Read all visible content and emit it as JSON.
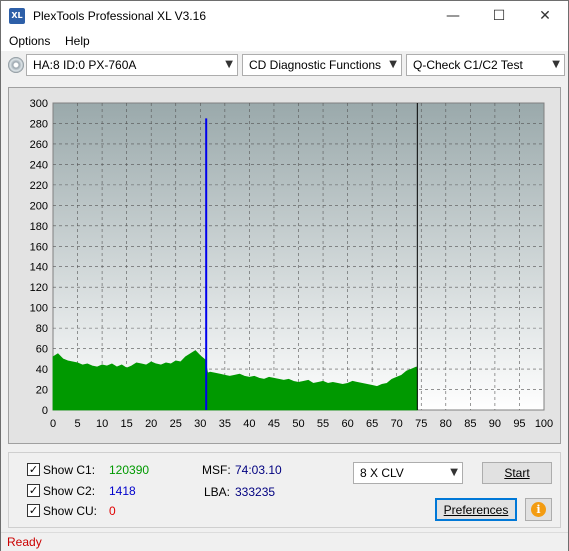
{
  "window": {
    "title": "PlexTools Professional XL V3.16",
    "icon_text": "XL",
    "minimize": "—",
    "maximize": "☐",
    "close": "✕"
  },
  "menu": {
    "items": [
      "Options",
      "Help"
    ]
  },
  "toolbar": {
    "drive": "HA:8 ID:0  PX-760A",
    "function": "CD Diagnostic Functions",
    "test": "Q-Check C1/C2 Test"
  },
  "chart_data": {
    "type": "area",
    "title": "",
    "xlabel": "",
    "ylabel": "",
    "xlim": [
      0,
      100
    ],
    "ylim": [
      0,
      300
    ],
    "x_ticks": [
      0,
      5,
      10,
      15,
      20,
      25,
      30,
      35,
      40,
      45,
      50,
      55,
      60,
      65,
      70,
      75,
      80,
      85,
      90,
      95,
      100
    ],
    "y_ticks": [
      0,
      20,
      40,
      60,
      80,
      100,
      120,
      140,
      160,
      180,
      200,
      220,
      240,
      260,
      280,
      300
    ],
    "grid": true,
    "colors": {
      "c1": "#009900",
      "c2_marker": "#0000ee",
      "end_marker": "#000000"
    },
    "series": [
      {
        "name": "C1",
        "x": [
          0,
          1,
          2,
          3,
          4,
          5,
          6,
          7,
          8,
          9,
          10,
          11,
          12,
          13,
          14,
          15,
          16,
          17,
          18,
          19,
          20,
          21,
          22,
          23,
          24,
          25,
          26,
          27,
          28,
          29,
          30,
          31,
          31.5,
          32,
          33,
          34,
          35,
          36,
          37,
          38,
          39,
          40,
          41,
          42,
          43,
          44,
          45,
          46,
          47,
          48,
          49,
          50,
          51,
          52,
          53,
          54,
          55,
          56,
          57,
          58,
          59,
          60,
          61,
          62,
          63,
          64,
          65,
          66,
          67,
          68,
          69,
          70,
          71,
          72,
          73,
          74,
          74.2
        ],
        "y": [
          52,
          55,
          50,
          48,
          47,
          46,
          44,
          45,
          43,
          42,
          44,
          43,
          45,
          42,
          44,
          41,
          43,
          46,
          45,
          44,
          47,
          45,
          44,
          46,
          45,
          48,
          47,
          52,
          55,
          58,
          53,
          49,
          36,
          37,
          36,
          35,
          34,
          33,
          34,
          35,
          33,
          32,
          33,
          31,
          30,
          32,
          31,
          30,
          29,
          30,
          28,
          27,
          28,
          29,
          26,
          27,
          28,
          26,
          27,
          26,
          25,
          26,
          28,
          27,
          26,
          25,
          24,
          23,
          25,
          26,
          30,
          32,
          34,
          38,
          40,
          42,
          40
        ]
      },
      {
        "name": "C2",
        "x": [
          31.2
        ],
        "y": [
          285
        ]
      }
    ],
    "end_marker_x": 74.2
  },
  "bottom": {
    "show_c1": "Show C1:",
    "c1_value": "120390",
    "show_c2": "Show C2:",
    "c2_value": "1418",
    "show_cu": "Show CU:",
    "cu_value": "0",
    "msf_label": "MSF:",
    "msf_value": "74:03.10",
    "lba_label": "LBA:",
    "lba_value": "333235",
    "speed": "8 X CLV",
    "start": "Start",
    "preferences": "Preferences",
    "info_icon": "i",
    "check": "✓",
    "colors": {
      "c1": "#009900",
      "c2": "#0000cc",
      "cu": "#e00000",
      "info": "#f39c12"
    }
  },
  "status": {
    "text": "Ready",
    "color": "#cc0000"
  }
}
